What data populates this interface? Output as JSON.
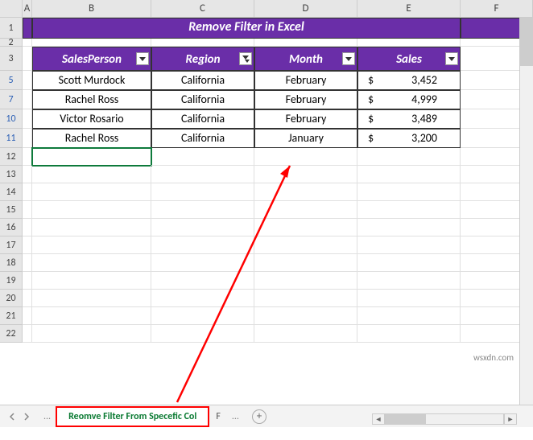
{
  "title": "Remove Filter in Excel",
  "columns": [
    "A",
    "B",
    "C",
    "D",
    "E",
    "F"
  ],
  "visible_row_numbers": [
    "1",
    "2",
    "3",
    "5",
    "7",
    "10",
    "11",
    "12",
    "13",
    "14",
    "15",
    "16",
    "17",
    "18",
    "19",
    "20",
    "21",
    "22"
  ],
  "headers": {
    "salesperson": "SalesPerson",
    "region": "Region",
    "month": "Month",
    "sales": "Sales"
  },
  "filter_states": {
    "salesperson": "unfiltered",
    "region": "filtered",
    "month": "unfiltered",
    "sales": "unfiltered"
  },
  "data_rows": [
    {
      "person": "Scott Murdock",
      "region": "California",
      "month": "February",
      "currency": "$",
      "sales": "3,452"
    },
    {
      "person": "Rachel Ross",
      "region": "California",
      "month": "February",
      "currency": "$",
      "sales": "4,999"
    },
    {
      "person": "Victor Rosario",
      "region": "California",
      "month": "February",
      "currency": "$",
      "sales": "3,489"
    },
    {
      "person": "Rachel Ross",
      "region": "California",
      "month": "January",
      "currency": "$",
      "sales": "3,200"
    }
  ],
  "active_tab": "Reomve Filter From Specefic Col",
  "next_tab_partial": "F",
  "tab_more": "...",
  "add_tab": "+",
  "watermark": "wsxdn.com",
  "chart_data": {
    "type": "table",
    "title": "Remove Filter in Excel",
    "columns": [
      "SalesPerson",
      "Region",
      "Month",
      "Sales"
    ],
    "rows": [
      [
        "Scott Murdock",
        "California",
        "February",
        3452
      ],
      [
        "Rachel Ross",
        "California",
        "February",
        4999
      ],
      [
        "Victor Rosario",
        "California",
        "February",
        3489
      ],
      [
        "Rachel Ross",
        "California",
        "January",
        3200
      ]
    ]
  }
}
